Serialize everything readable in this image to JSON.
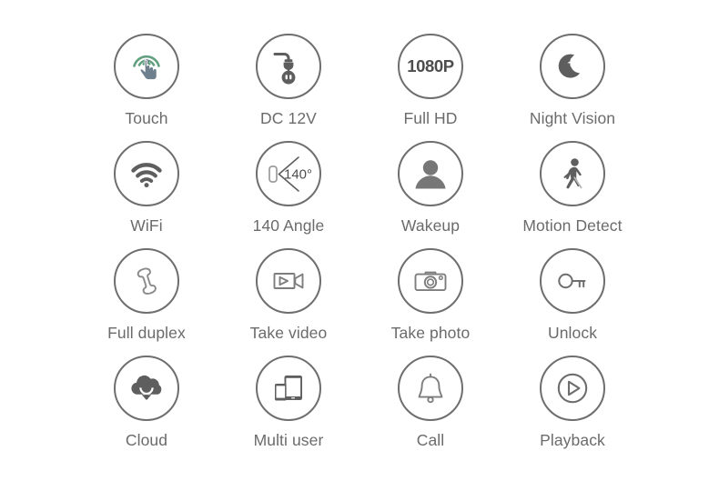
{
  "page": {
    "title": "Camera Feature Icon Grid",
    "background_color": "#ffffff",
    "columns": 4,
    "rows": 4
  },
  "colors": {
    "circle_stroke": "#6e6e6e",
    "icon_stroke": "#5e5e5e",
    "icon_fill": "#6b6b6b",
    "label_text": "#6b6b6b",
    "touch_hand": "#6e7f8e",
    "touch_waves": "#62a07f",
    "hd_text": "#4d4d4d"
  },
  "features": [
    {
      "label": "Touch",
      "icon": "touch-gesture-icon",
      "row": 1,
      "col": 1
    },
    {
      "label": "DC 12V",
      "icon": "power-plug-icon",
      "row": 1,
      "col": 2
    },
    {
      "label": "Full HD",
      "icon": "1080p-text-icon",
      "row": 1,
      "col": 3,
      "icon_text": "1080P"
    },
    {
      "label": "Night Vision",
      "icon": "moon-star-icon",
      "row": 1,
      "col": 4
    },
    {
      "label": "WiFi",
      "icon": "wifi-icon",
      "row": 2,
      "col": 1
    },
    {
      "label": "140 Angle",
      "icon": "view-angle-icon",
      "row": 2,
      "col": 2,
      "icon_text": "140°"
    },
    {
      "label": "Wakeup",
      "icon": "person-avatar-icon",
      "row": 2,
      "col": 3
    },
    {
      "label": "Motion Detect",
      "icon": "walking-person-icon",
      "row": 2,
      "col": 4
    },
    {
      "label": "Full duplex",
      "icon": "telephone-handset-icon",
      "row": 3,
      "col": 1
    },
    {
      "label": "Take video",
      "icon": "video-camera-icon",
      "row": 3,
      "col": 2
    },
    {
      "label": "Take photo",
      "icon": "photo-camera-icon",
      "row": 3,
      "col": 3
    },
    {
      "label": "Unlock",
      "icon": "key-icon",
      "row": 3,
      "col": 4
    },
    {
      "label": "Cloud",
      "icon": "cloud-download-icon",
      "row": 4,
      "col": 1
    },
    {
      "label": "Multi user",
      "icon": "tablet-phone-icon",
      "row": 4,
      "col": 2
    },
    {
      "label": "Call",
      "icon": "bell-icon",
      "row": 4,
      "col": 3
    },
    {
      "label": "Playback",
      "icon": "play-button-icon",
      "row": 4,
      "col": 4
    }
  ]
}
